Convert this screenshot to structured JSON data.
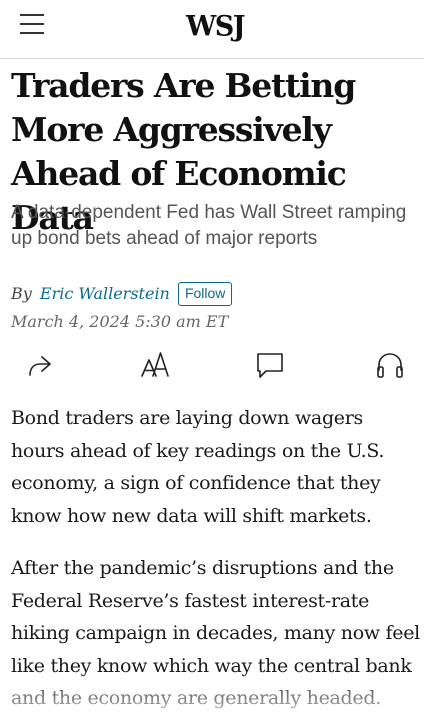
{
  "header": {
    "logo": "WSJ",
    "menu_icon": "hamburger-menu-icon"
  },
  "article": {
    "headline": "Traders Are Betting More Aggressively Ahead of Economic Data",
    "dek": "A data-dependent Fed has Wall Street ramping up bond bets ahead of major reports",
    "byline_prefix": "By",
    "author": "Eric Wallerstein",
    "follow_label": "Follow",
    "date": "March 4, 2024 5:30 am ET",
    "paragraphs": [
      "Bond traders are laying down wagers hours ahead of key readings on the U.S. economy, a sign of confidence that they know how new data will shift markets.",
      "After the pandemic’s disruptions and the Federal Reserve’s fastest interest-rate hiking campaign in decades, many now feel like they know which way the central bank and the economy are generally headed."
    ]
  },
  "toolbar": {
    "icons": [
      "share-icon",
      "text-size-icon",
      "comment-icon",
      "listen-icon"
    ]
  },
  "colors": {
    "accent": "#0b6a8f",
    "divider": "#d9d9d9",
    "dek": "#555555"
  }
}
